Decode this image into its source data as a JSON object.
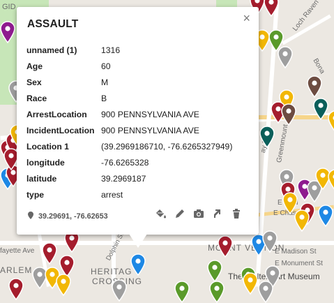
{
  "map": {
    "labels": {
      "gwynns": "GID",
      "loch_raven": "Loch Raven Rd",
      "bona": "Bona",
      "greenmount": "Greenmount",
      "ay_st": "ay St",
      "e_biddle": "E Bidd",
      "e_chase": "E Chase St",
      "dolphin": "Dolphin St",
      "lafayette": "fayette Ave",
      "harlem": "ARLEM",
      "heritage": "HERITAG",
      "crossing": "CROSSING",
      "mount_vernon": "MOUNT VERNON",
      "e_madison": "E Madison St",
      "e_monument": "E Monument St",
      "walters": "The Walters Art Museum"
    }
  },
  "popup": {
    "title": "ASSAULT",
    "close_glyph": "×",
    "fields": [
      {
        "key": "unnamed (1)",
        "value": "1316"
      },
      {
        "key": "Age",
        "value": "60"
      },
      {
        "key": "Sex",
        "value": "M"
      },
      {
        "key": "Race",
        "value": "B"
      },
      {
        "key": "ArrestLocation",
        "value": "900 PENNSYLVANIA AVE"
      },
      {
        "key": "IncidentLocation",
        "value": "900 PENNSYLVANIA AVE"
      },
      {
        "key": "Location 1",
        "value": "(39.2969186710, -76.6265327949)"
      },
      {
        "key": "longitude",
        "value": "-76.6265328"
      },
      {
        "key": "latitude",
        "value": "39.2969187"
      },
      {
        "key": "type",
        "value": "arrest"
      }
    ],
    "coordinates": "39.29691, -76.62653"
  },
  "colors": {
    "red": "#a51d2d",
    "yellow": "#f2b705",
    "green": "#5a9a2a",
    "grey": "#9e9e9e",
    "blue": "#1e88e5",
    "teal": "#0b5f5a",
    "purple": "#8e1b8e",
    "brown": "#6d4c41"
  }
}
